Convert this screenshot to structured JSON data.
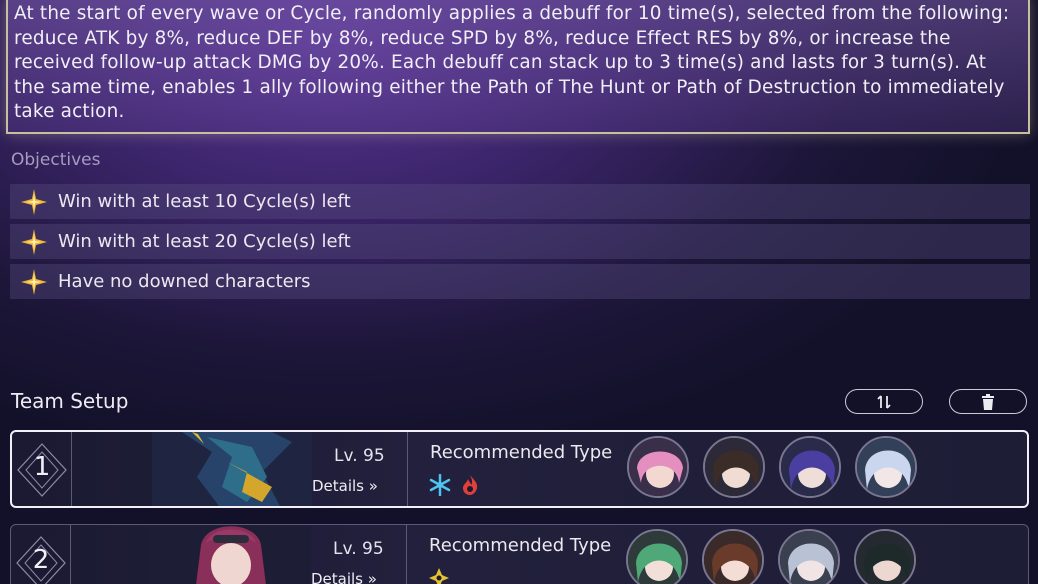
{
  "description": "At the start of every wave or Cycle, randomly applies a debuff for 10 time(s), selected from the following: reduce ATK by 8%, reduce DEF by 8%, reduce SPD by 8%, reduce Effect RES by 8%, or increase the received follow-up attack DMG by 20%. Each debuff can stack up to 3 time(s) and lasts for 3 turn(s). At the same time, enables 1 ally following either the Path of The Hunt or Path of Destruction to immediately take action.",
  "objectives": {
    "title": "Objectives",
    "items": [
      {
        "label": "Win with at least 10 Cycle(s) left"
      },
      {
        "label": "Win with at least 20 Cycle(s) left"
      },
      {
        "label": "Have no downed characters"
      }
    ]
  },
  "team_setup": {
    "title": "Team Setup",
    "buttons": [
      {
        "name": "swap-button",
        "icon": "swap-arrows-icon"
      },
      {
        "name": "delete-button",
        "icon": "trash-icon"
      }
    ],
    "teams": [
      {
        "number": "1",
        "level": "Lv. 95",
        "details_label": "Details",
        "recommended_label": "Recommended Type",
        "types": [
          "ice-type-icon",
          "fire-type-icon"
        ],
        "colors": {
          "ice": "#4ec3f0",
          "fire": "#e0403a"
        },
        "avatars": [
          "avatar-pink-hair",
          "avatar-brown-hair",
          "avatar-purple-hair",
          "avatar-silver-hair"
        ]
      },
      {
        "number": "2",
        "level": "Lv. 95",
        "details_label": "Details",
        "recommended_label": "Recommended Type",
        "types": [
          "quantum-type-icon"
        ],
        "colors": {
          "quantum": "#e6c230"
        },
        "avatars": [
          "avatar-green-hair",
          "avatar-brown-red-hair",
          "avatar-grey-hair",
          "avatar-dark-hair"
        ]
      }
    ]
  }
}
